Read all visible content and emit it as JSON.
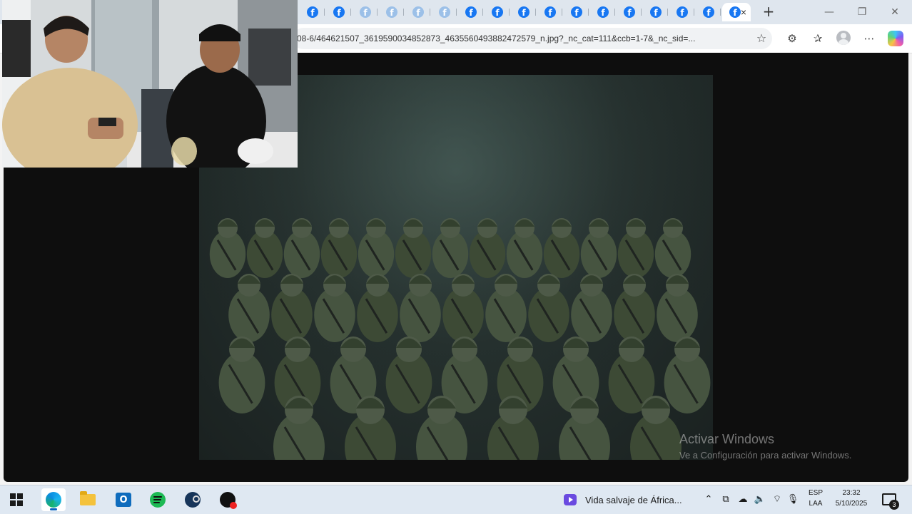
{
  "browser": {
    "tabs": [
      {
        "icon": "facebook-icon",
        "faded": false
      },
      {
        "icon": "facebook-icon",
        "faded": false
      },
      {
        "icon": "facebook-icon",
        "faded": true
      },
      {
        "icon": "facebook-icon",
        "faded": true
      },
      {
        "icon": "facebook-icon",
        "faded": true
      },
      {
        "icon": "facebook-icon",
        "faded": true
      },
      {
        "icon": "facebook-icon",
        "faded": false
      },
      {
        "icon": "facebook-icon",
        "faded": false
      },
      {
        "icon": "facebook-icon",
        "faded": false
      },
      {
        "icon": "facebook-icon",
        "faded": false
      },
      {
        "icon": "facebook-icon",
        "faded": false
      },
      {
        "icon": "facebook-icon",
        "faded": false
      },
      {
        "icon": "facebook-icon",
        "faded": false
      },
      {
        "icon": "facebook-icon",
        "faded": false
      },
      {
        "icon": "facebook-icon",
        "faded": false
      },
      {
        "icon": "facebook-icon",
        "faded": false
      }
    ],
    "active_tab_close": "×",
    "new_tab": "+",
    "address_url": "08-6/464621507_3619590034852873_4635560493882472579_n.jpg?_nc_cat=111&ccb=1-7&_nc_sid=...",
    "accent_color": "#1877f2"
  },
  "watermark": {
    "title": "Activar Windows",
    "subtitle": "Ve a Configuración para activar Windows."
  },
  "taskbar": {
    "apps": [
      "start-icon",
      "edge-icon",
      "file-explorer-icon",
      "outlook-icon",
      "spotify-icon",
      "steam-icon",
      "app-icon"
    ],
    "media_title": "Vida salvaje de África...",
    "lang_line1": "ESP",
    "lang_line2": "LAA",
    "time": "23:32",
    "date": "5/10/2025",
    "notification_count": "3"
  }
}
